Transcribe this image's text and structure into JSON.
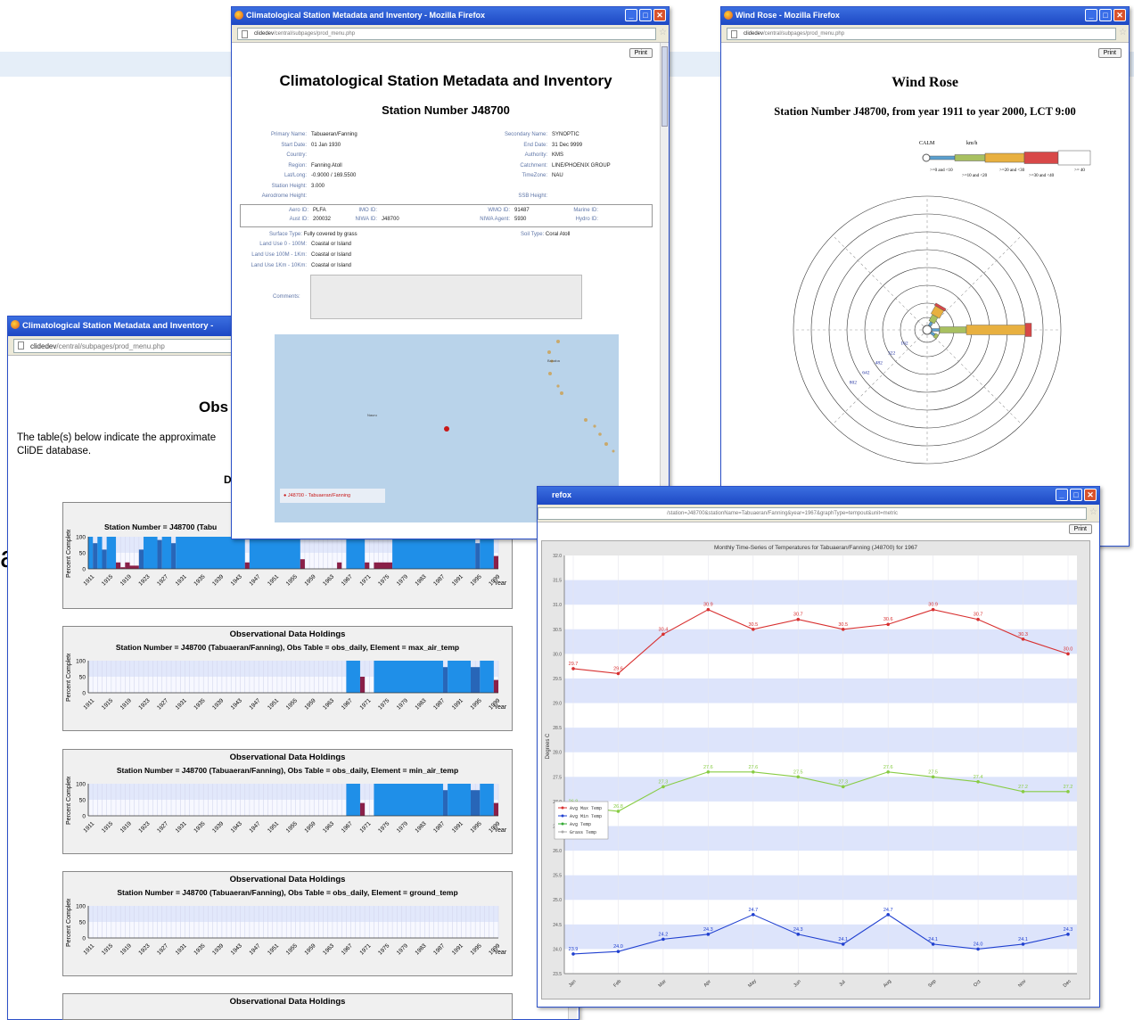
{
  "bg_text": {
    "letter": "a"
  },
  "obs_window": {
    "title": "Climatological Station Metadata and Inventory -",
    "url_host": "clidedev",
    "url_path": "/central/subpages/prod_menu.php",
    "heading": "Obs",
    "intro_line1": "The table(s) below indicate the approximate",
    "intro_line2": "CliDE database.",
    "subheading": "D",
    "scroll_arrow": "⌄"
  },
  "chart_data": [
    {
      "type": "bar",
      "title": "Observational Data Holdings",
      "subtitle": "Station Number = J48700 (Tabuaeran/Fanning), Obs Table = obs_daily, Element = max_air_temp",
      "ylabel": "Percent Complete",
      "xlabel": "Year",
      "yticks": [
        "100",
        "50",
        "0"
      ],
      "ylim": [
        0,
        100
      ],
      "categories": [
        "1911",
        "1915",
        "1919",
        "1923",
        "1927",
        "1931",
        "1935",
        "1939",
        "1943",
        "1947",
        "1951",
        "1955",
        "1959",
        "1963",
        "1967",
        "1971",
        "1975",
        "1979",
        "1983",
        "1987",
        "1991",
        "1995",
        "1999"
      ],
      "segments": [
        {
          "from": 1967,
          "to": 1970,
          "value": 100
        },
        {
          "from": 1970,
          "to": 1971,
          "value": 50
        },
        {
          "from": 1973,
          "to": 1988,
          "value": 100
        },
        {
          "from": 1988,
          "to": 1989,
          "value": 80
        },
        {
          "from": 1989,
          "to": 1994,
          "value": 100
        },
        {
          "from": 1994,
          "to": 1996,
          "value": 80
        },
        {
          "from": 1996,
          "to": 1999,
          "value": 100
        },
        {
          "from": 1999,
          "to": 2000,
          "value": 40
        }
      ]
    },
    {
      "type": "bar",
      "title": "Observational Data Holdings",
      "subtitle": "Station Number = J48700 (Tabuaeran/Fanning), Obs Table = obs_daily, Element = min_air_temp",
      "ylabel": "Percent Complete",
      "xlabel": "Year",
      "yticks": [
        "100",
        "50",
        "0"
      ],
      "ylim": [
        0,
        100
      ],
      "categories": [
        "1911",
        "1915",
        "1919",
        "1923",
        "1927",
        "1931",
        "1935",
        "1939",
        "1943",
        "1947",
        "1951",
        "1955",
        "1959",
        "1963",
        "1967",
        "1971",
        "1975",
        "1979",
        "1983",
        "1987",
        "1991",
        "1995",
        "1999"
      ],
      "segments": [
        {
          "from": 1967,
          "to": 1970,
          "value": 100
        },
        {
          "from": 1970,
          "to": 1971,
          "value": 40
        },
        {
          "from": 1973,
          "to": 1988,
          "value": 100
        },
        {
          "from": 1988,
          "to": 1989,
          "value": 80
        },
        {
          "from": 1989,
          "to": 1994,
          "value": 100
        },
        {
          "from": 1994,
          "to": 1996,
          "value": 80
        },
        {
          "from": 1996,
          "to": 1999,
          "value": 100
        },
        {
          "from": 1999,
          "to": 2000,
          "value": 40
        }
      ]
    },
    {
      "type": "bar",
      "title": "Observational Data Holdings",
      "subtitle": "Station Number = J48700 (Tabuaeran/Fanning), Obs Table = obs_daily, Element = ground_temp",
      "ylabel": "Percent Complete",
      "xlabel": "Year",
      "yticks": [
        "100",
        "50",
        "0"
      ],
      "ylim": [
        0,
        100
      ],
      "categories": [
        "1911",
        "1915",
        "1919",
        "1923",
        "1927",
        "1931",
        "1935",
        "1939",
        "1943",
        "1947",
        "1951",
        "1955",
        "1959",
        "1963",
        "1967",
        "1971",
        "1975",
        "1979",
        "1983",
        "1987",
        "1991",
        "1995",
        "1999"
      ],
      "segments": []
    },
    {
      "type": "bar",
      "title": "",
      "subtitle": "Station Number = J48700 (Tabu",
      "ylabel": "Percent Complete",
      "xlabel": "Year",
      "yticks": [
        "100",
        "50",
        "0"
      ],
      "ylim": [
        0,
        100
      ],
      "categories": [
        "1911",
        "1915",
        "1919",
        "1923",
        "1927",
        "1931",
        "1935",
        "1939",
        "1943",
        "1947",
        "1951",
        "1955",
        "1959",
        "1963",
        "1967",
        "1971",
        "1975",
        "1979",
        "1983",
        "1987",
        "1991",
        "1995",
        "1999"
      ],
      "segments": [
        {
          "from": 1911,
          "to": 1912,
          "value": 100
        },
        {
          "from": 1912,
          "to": 1913,
          "value": 80
        },
        {
          "from": 1913,
          "to": 1914,
          "value": 100
        },
        {
          "from": 1914,
          "to": 1915,
          "value": 60
        },
        {
          "from": 1915,
          "to": 1917,
          "value": 100
        },
        {
          "from": 1917,
          "to": 1918,
          "value": 20
        },
        {
          "from": 1918,
          "to": 1919,
          "value": 5
        },
        {
          "from": 1919,
          "to": 1920,
          "value": 20
        },
        {
          "from": 1920,
          "to": 1922,
          "value": 10
        },
        {
          "from": 1922,
          "to": 1923,
          "value": 60
        },
        {
          "from": 1923,
          "to": 1926,
          "value": 100
        },
        {
          "from": 1926,
          "to": 1927,
          "value": 90
        },
        {
          "from": 1927,
          "to": 1929,
          "value": 100
        },
        {
          "from": 1929,
          "to": 1930,
          "value": 80
        },
        {
          "from": 1930,
          "to": 1945,
          "value": 100
        },
        {
          "from": 1945,
          "to": 1946,
          "value": 20
        },
        {
          "from": 1946,
          "to": 1957,
          "value": 100
        },
        {
          "from": 1957,
          "to": 1958,
          "value": 30
        },
        {
          "from": 1965,
          "to": 1966,
          "value": 20
        },
        {
          "from": 1967,
          "to": 1971,
          "value": 100
        },
        {
          "from": 1971,
          "to": 1972,
          "value": 20
        },
        {
          "from": 1973,
          "to": 1977,
          "value": 20
        },
        {
          "from": 1977,
          "to": 1995,
          "value": 100
        },
        {
          "from": 1995,
          "to": 1996,
          "value": 80
        },
        {
          "from": 1996,
          "to": 1999,
          "value": 100
        },
        {
          "from": 1999,
          "to": 2000,
          "value": 40
        }
      ]
    },
    {
      "type": "line",
      "title": "Monthly Time-Series of Temperatures for Tabuaeran/Fanning (J48700) for 1967",
      "ylabel": "Degrees C",
      "ylim": [
        23.5,
        32.0
      ],
      "yticks": [
        "32.0",
        "31.5",
        "31.0",
        "30.5",
        "30.0",
        "29.5",
        "29.0",
        "28.5",
        "28.0",
        "27.5",
        "27.0",
        "26.5",
        "26.0",
        "25.5",
        "25.0",
        "24.5",
        "24.0",
        "23.5"
      ],
      "categories": [
        "Jan",
        "Feb",
        "Mar",
        "Apr",
        "May",
        "Jun",
        "Jul",
        "Aug",
        "Sep",
        "Oct",
        "Nov",
        "Dec"
      ],
      "legend": [
        "Avg Max Temp",
        "Avg Min Temp",
        "Avg Temp",
        "Grass Temp"
      ],
      "series": [
        {
          "name": "Avg Max Temp",
          "color": "#d83030",
          "values": [
            29.7,
            29.6,
            30.4,
            30.9,
            30.5,
            30.7,
            30.5,
            30.6,
            30.9,
            30.7,
            30.3,
            30.0
          ],
          "labels": [
            "29.7",
            "29.6",
            "30.4",
            "30.9",
            "30.5",
            "30.7",
            "30.5",
            "30.6",
            "30.9",
            "30.7",
            "30.3",
            "30.0"
          ]
        },
        {
          "name": "Avg Min Temp",
          "color": "#2040d0",
          "values": [
            23.9,
            23.95,
            24.2,
            24.3,
            24.7,
            24.3,
            24.1,
            24.7,
            24.1,
            24.0,
            24.1,
            24.3
          ],
          "labels": [
            "23.9",
            "24.0",
            "24.2",
            "24.3",
            "24.7",
            "24.3",
            "24.1",
            "24.7",
            "24.1",
            "24.0",
            "24.1",
            "24.3"
          ]
        },
        {
          "name": "Avg Temp",
          "color": "#88cc44",
          "values": [
            26.9,
            26.8,
            27.3,
            27.6,
            27.6,
            27.5,
            27.3,
            27.6,
            27.5,
            27.4,
            27.2,
            27.2
          ],
          "labels": [
            "26.9",
            "26.8",
            "27.3",
            "27.6",
            "27.6",
            "27.5",
            "27.3",
            "27.6",
            "27.5",
            "27.4",
            "27.2",
            "27.2"
          ]
        }
      ]
    },
    {
      "type": "rose",
      "title": "Wind Rose",
      "subtitle": "Station Number J48700, from year 1911 to year 2000, LCT 9:00",
      "legend_labels": [
        "CALM",
        "km/h"
      ],
      "legend_bins": [
        ">=0 and <10",
        ">=10 and <20",
        ">=20 and <30",
        ">=30 and <40",
        ">= 40"
      ],
      "colors": [
        "#5aa0d0",
        "#a8c060",
        "#e8b040",
        "#d84848",
        "#ffffff"
      ],
      "ring_labels": [
        "162",
        "322",
        "482",
        "642",
        "802"
      ]
    }
  ],
  "meta_window": {
    "title": "Climatological Station Metadata and Inventory - Mozilla Firefox",
    "url_host": "clidedev",
    "url_path": "/central/subpages/prod_menu.php",
    "print": "Print",
    "heading": "Climatological Station Metadata and Inventory",
    "station_heading": "Station Number J48700",
    "left_fields": [
      {
        "k": "Primary Name:",
        "v": "Tabuaeran/Fanning"
      },
      {
        "k": "Start Date:",
        "v": "01 Jan 1930"
      },
      {
        "k": "Country:",
        "v": ""
      },
      {
        "k": "Region:",
        "v": "Fanning Atoll"
      },
      {
        "k": "Lat/Long:",
        "v": "-0.9000 / 169.5500"
      },
      {
        "k": "Station Height:",
        "v": "3.000"
      },
      {
        "k": "Aerodrome Height:",
        "v": ""
      }
    ],
    "right_fields": [
      {
        "k": "Secondary Name:",
        "v": "SYNOPTIC"
      },
      {
        "k": "End Date:",
        "v": "31 Dec 9999"
      },
      {
        "k": "Authority:",
        "v": "KMS"
      },
      {
        "k": "Catchment:",
        "v": "LINE/PHOENIX GROUP"
      },
      {
        "k": "TimeZone:",
        "v": "NAU"
      },
      {
        "k": "",
        "v": ""
      },
      {
        "k": "SSB Height:",
        "v": ""
      }
    ],
    "ids_row1": [
      {
        "k": "Aero ID:",
        "v": "PLFA"
      },
      {
        "k": "IMO ID:",
        "v": ""
      },
      {
        "k": "WMO ID:",
        "v": "91487"
      },
      {
        "k": "Marine ID:",
        "v": ""
      }
    ],
    "ids_row2": [
      {
        "k": "Aust ID:",
        "v": "200032"
      },
      {
        "k": "NIWA ID:",
        "v": "J48700"
      },
      {
        "k": "NIWA Agent:",
        "v": "5930"
      },
      {
        "k": "Hydro ID:",
        "v": ""
      }
    ],
    "surface_type_k": "Surface Type:",
    "surface_type_v": "Fully covered by grass",
    "soil_type_k": "Soil Type:",
    "soil_type_v": "Coral Atoll",
    "landuse": [
      {
        "k": "Land Use 0 - 100M:",
        "v": "Coastal or Island"
      },
      {
        "k": "Land Use 100M - 1Km:",
        "v": "Coastal or Island"
      },
      {
        "k": "Land Use 1Km - 10Km:",
        "v": "Coastal or Island"
      }
    ],
    "comments_k": "Comments:",
    "map_legend": "J48700 - Tabuaeran/Fanning",
    "map_label1": "Nauru",
    "map_label2": "Banaba"
  },
  "rose_window": {
    "title": "Wind Rose - Mozilla Firefox",
    "url_host": "clidedev",
    "url_path": "/central/subpages/prod_menu.php",
    "print": "Print"
  },
  "temp_window": {
    "title": "refox",
    "url_path": "/station=J48700&stationName=Tabuaeran/Fanning&year=1967&graphType=tempout&unit=metric",
    "print": "Print"
  }
}
